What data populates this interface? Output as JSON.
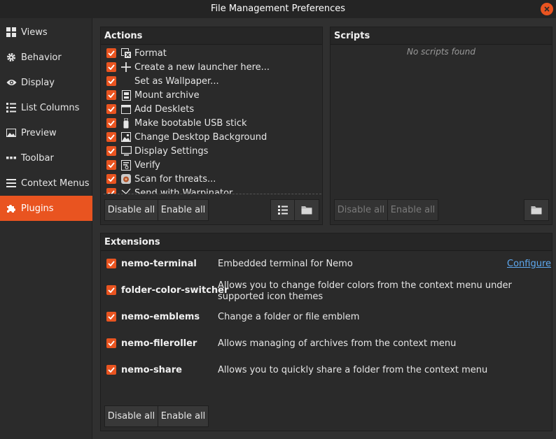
{
  "window": {
    "title": "File Management Preferences"
  },
  "sidebar": {
    "items": [
      {
        "label": "Views",
        "icon": "grid-icon"
      },
      {
        "label": "Behavior",
        "icon": "gear-icon"
      },
      {
        "label": "Display",
        "icon": "eye-icon"
      },
      {
        "label": "List Columns",
        "icon": "list-icon"
      },
      {
        "label": "Preview",
        "icon": "image-icon"
      },
      {
        "label": "Toolbar",
        "icon": "dots-icon"
      },
      {
        "label": "Context Menus",
        "icon": "menu-icon"
      },
      {
        "label": "Plugins",
        "icon": "puzzle-icon",
        "active": true
      }
    ]
  },
  "actions": {
    "header": "Actions",
    "items": [
      {
        "label": "Format",
        "icon": "format-icon"
      },
      {
        "label": "Create a new launcher here...",
        "icon": "plus-icon"
      },
      {
        "label": "Set as Wallpaper...",
        "icon": ""
      },
      {
        "label": "Mount archive",
        "icon": "archive-icon"
      },
      {
        "label": "Add Desklets",
        "icon": "desklet-icon"
      },
      {
        "label": "Make bootable USB stick",
        "icon": "usb-icon"
      },
      {
        "label": "Change Desktop Background",
        "icon": "wallpaper-icon"
      },
      {
        "label": "Display Settings",
        "icon": "monitor-icon"
      },
      {
        "label": "Verify",
        "icon": "verify-icon"
      },
      {
        "label": "Scan for threats...",
        "icon": "shield-scan-icon"
      },
      {
        "label": "Send with Warpinator",
        "icon": "warpinator-icon"
      }
    ],
    "disable_all": "Disable all",
    "enable_all": "Enable all"
  },
  "scripts": {
    "header": "Scripts",
    "empty": "No scripts found",
    "disable_all": "Disable all",
    "enable_all": "Enable all"
  },
  "extensions": {
    "header": "Extensions",
    "items": [
      {
        "name": "nemo-terminal",
        "description": "Embedded terminal for Nemo",
        "configure": "Configure"
      },
      {
        "name": "folder-color-switcher",
        "description": "Allows you to change folder colors from the context menu under supported icon themes"
      },
      {
        "name": "nemo-emblems",
        "description": "Change a folder or file emblem"
      },
      {
        "name": "nemo-fileroller",
        "description": "Allows managing of archives from the context menu"
      },
      {
        "name": "nemo-share",
        "description": "Allows you to quickly share a folder from the context menu"
      }
    ],
    "disable_all": "Disable all",
    "enable_all": "Enable all"
  },
  "colors": {
    "accent": "#e95420",
    "link": "#5ea9f0"
  }
}
